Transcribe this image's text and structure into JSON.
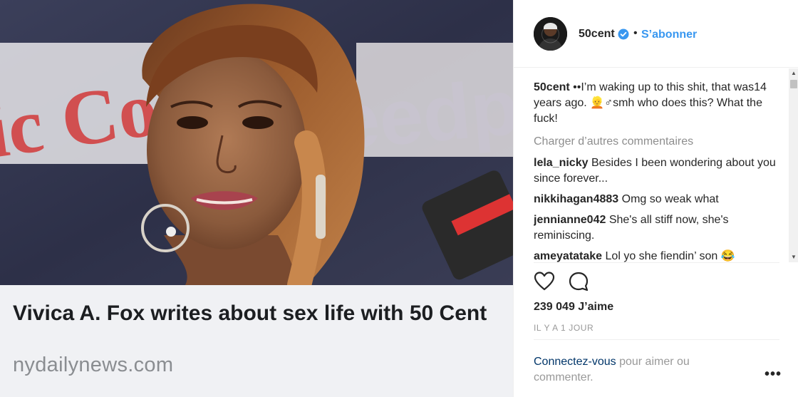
{
  "media": {
    "headline": "Vivica A. Fox writes about sex life with 50 Cent",
    "domain": "nydailynews.com",
    "backdrop_text": [
      "ic Co",
      "eedpo"
    ]
  },
  "header": {
    "username": "50cent",
    "separator": "•",
    "follow_label": "S’abonner"
  },
  "caption": {
    "username": "50cent",
    "text": "••I’m waking up to this shit, that was14 years ago. 👱♂smh who does this? What the fuck!"
  },
  "load_more_label": "Charger d’autres commentaires",
  "comments": [
    {
      "user": "lela_nicky",
      "text": "Besides I been wondering about you since forever..."
    },
    {
      "user": "nikkihagan4883",
      "text": "Omg so weak what"
    },
    {
      "user": "jennianne042",
      "text": "She's all stiff now, she's reminiscing."
    },
    {
      "user": "ameyatatake",
      "text": "Lol yo she fiendin’ son 😂"
    }
  ],
  "likes": "239 049 J’aime",
  "time": "IL Y A 1 JOUR",
  "login": {
    "link": "Connectez-vous",
    "rest": " pour aimer ou commenter."
  },
  "more_label": "•••",
  "colors": {
    "accent": "#3897f0",
    "link_dark": "#003569",
    "muted": "#8e8e8e",
    "text": "#262626"
  },
  "icons": [
    "verified-badge-icon",
    "heart-icon",
    "comment-icon",
    "more-options-icon",
    "scroll-up-arrow",
    "scroll-down-arrow"
  ]
}
